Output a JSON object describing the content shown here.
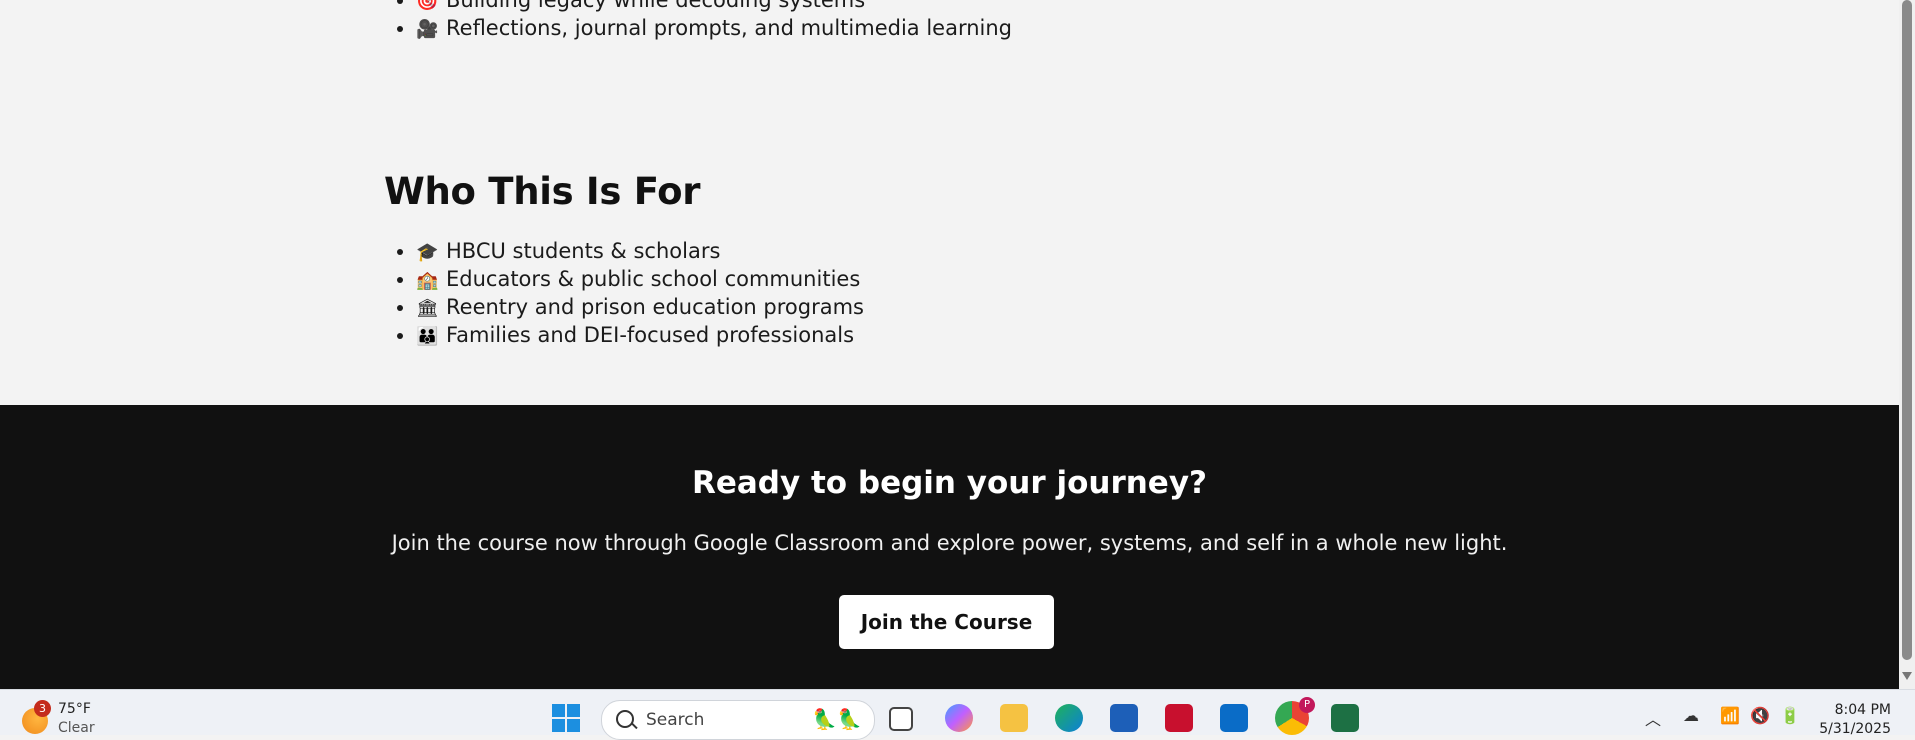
{
  "top_list": [
    {
      "icon": "🎯",
      "text": "Building legacy while decoding systems"
    },
    {
      "icon": "🎥",
      "text": "Reflections, journal prompts, and multimedia learning"
    }
  ],
  "who": {
    "title": "Who This Is For",
    "items": [
      {
        "icon": "🎓",
        "text": "HBCU students & scholars"
      },
      {
        "icon": "🏫",
        "text": "Educators & public school communities"
      },
      {
        "icon": "🏛",
        "text": "Reentry and prison education programs"
      },
      {
        "icon": "👪",
        "text": "Families and DEI-focused professionals"
      }
    ]
  },
  "cta": {
    "title": "Ready to begin your journey?",
    "text": "Join the course now through Google Classroom and explore power, systems, and self in a whole new light.",
    "button": "Join the Course"
  },
  "taskbar": {
    "weather_badge": "3",
    "temperature": "75°F",
    "condition": "Clear",
    "search_placeholder": "Search",
    "time": "8:04 PM",
    "date": "5/31/2025",
    "chrome_profile_letter": "P"
  }
}
